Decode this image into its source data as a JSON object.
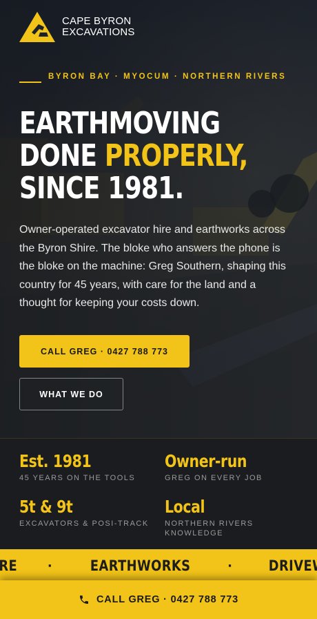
{
  "brand": {
    "line1": "CAPE BYRON",
    "line2": "EXCAVATIONS",
    "logo_icon": "excavator-triangle-logo",
    "accent_color": "#f2c318"
  },
  "hero": {
    "eyebrow": "BYRON BAY · MYOCUM · NORTHERN RIVERS",
    "headline_line1": "EARTHMOVING",
    "headline_line2_a": "DONE ",
    "headline_line2_b": "PROPERLY,",
    "headline_line3": "SINCE 1981.",
    "lead": "Owner-operated excavator hire and earthworks across the Byron Shire. The bloke who answers the phone is the bloke on the machine: Greg Southern, shaping this country for 45 years, with care for the land and a thought for keeping your costs down.",
    "primary_cta": "CALL GREG · 0427 788 773",
    "secondary_cta": "WHAT WE DO"
  },
  "stats": [
    {
      "value": "Est. 1981",
      "label": "45 YEARS ON THE TOOLS"
    },
    {
      "value": "Owner-run",
      "label": "GREG ON EVERY JOB"
    },
    {
      "value": "5t & 9t",
      "label": "EXCAVATORS & POSI-TRACK"
    },
    {
      "value": "Local",
      "label": "NORTHERN RIVERS KNOWLEDGE"
    }
  ],
  "marquee": {
    "items": [
      "RE",
      "EARTHWORKS",
      "DRIVEWAYS"
    ],
    "separator": "·"
  },
  "callbar": {
    "label": "CALL GREG · 0427 788 773",
    "icon": "phone-icon"
  }
}
